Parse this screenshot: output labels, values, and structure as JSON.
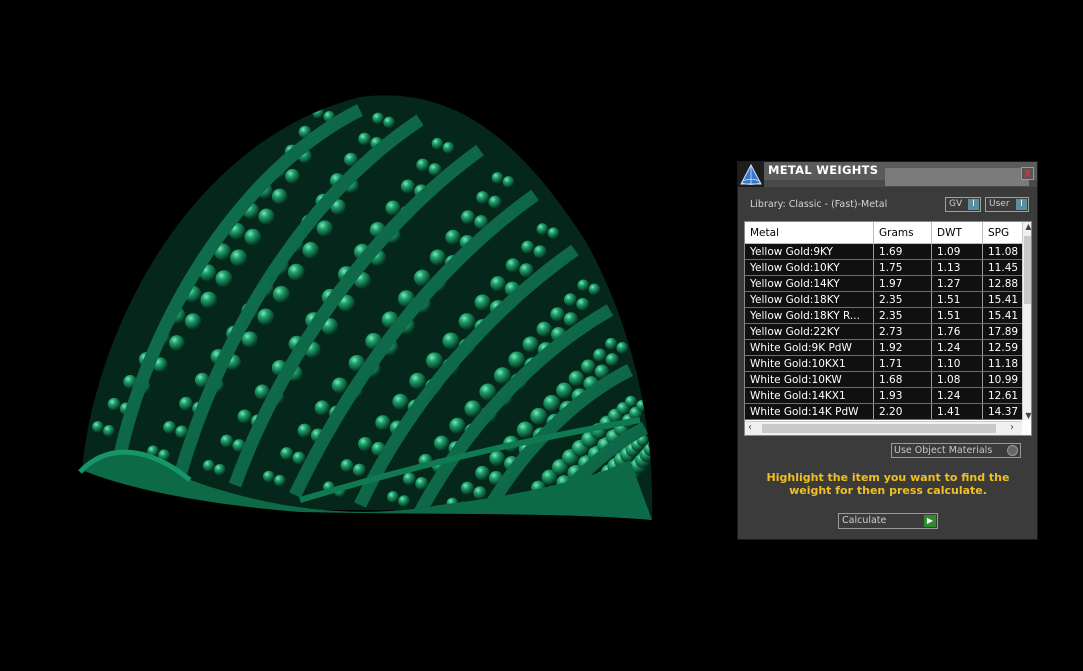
{
  "panel": {
    "title": "METAL WEIGHTS",
    "close_label": "X",
    "library_label": "Library: Classic - (Fast)-Metal",
    "gv_toggle": "GV",
    "user_toggle": "User",
    "toggle_knob": "I"
  },
  "table": {
    "headers": {
      "metal": "Metal",
      "grams": "Grams",
      "dwt": "DWT",
      "spg": "SPG"
    },
    "rows": [
      {
        "metal": "Yellow Gold:9KY",
        "grams": "1.69",
        "dwt": "1.09",
        "spg": "11.08"
      },
      {
        "metal": "Yellow Gold:10KY",
        "grams": "1.75",
        "dwt": "1.13",
        "spg": "11.45"
      },
      {
        "metal": "Yellow Gold:14KY",
        "grams": "1.97",
        "dwt": "1.27",
        "spg": "12.88"
      },
      {
        "metal": "Yellow Gold:18KY",
        "grams": "2.35",
        "dwt": "1.51",
        "spg": "15.41"
      },
      {
        "metal": "Yellow Gold:18KY R...",
        "grams": "2.35",
        "dwt": "1.51",
        "spg": "15.41"
      },
      {
        "metal": "Yellow Gold:22KY",
        "grams": "2.73",
        "dwt": "1.76",
        "spg": "17.89"
      },
      {
        "metal": "White Gold:9K PdW",
        "grams": "1.92",
        "dwt": "1.24",
        "spg": "12.59"
      },
      {
        "metal": "White Gold:10KX1",
        "grams": "1.71",
        "dwt": "1.10",
        "spg": "11.18"
      },
      {
        "metal": "White Gold:10KW",
        "grams": "1.68",
        "dwt": "1.08",
        "spg": "10.99"
      },
      {
        "metal": "White Gold:14KX1",
        "grams": "1.93",
        "dwt": "1.24",
        "spg": "12.61"
      },
      {
        "metal": "White Gold:14K PdW",
        "grams": "2.20",
        "dwt": "1.41",
        "spg": "14.37"
      }
    ]
  },
  "use_object_materials": "Use Object Materials",
  "instruction": "Highlight the item you want to find the weight for then press calculate.",
  "calculate_label": "Calculate",
  "colors": {
    "panel": "#3b3b3b",
    "instruction": "#f0c020",
    "model": "#0f6e4a"
  }
}
